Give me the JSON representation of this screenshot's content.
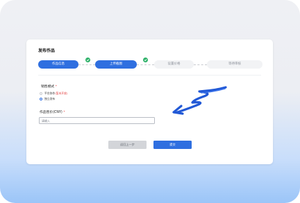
{
  "page": {
    "title": "发布作品"
  },
  "steps": [
    {
      "label": "作品信息",
      "status": "done"
    },
    {
      "label": "上传截图",
      "status": "done"
    },
    {
      "label": "设置价格",
      "status": "todo"
    },
    {
      "label": "等待审核",
      "status": "todo"
    }
  ],
  "sale_mode": {
    "label": "销售模式",
    "required_mark": "*",
    "options": [
      {
        "label": "平台协作",
        "note": "(暂未开放)",
        "selected": false
      },
      {
        "label": "独立发布",
        "selected": true
      }
    ]
  },
  "price": {
    "label": "作品售价(CNY)",
    "required_mark": "*",
    "placeholder": "请输入"
  },
  "buttons": {
    "prev": "返回上一步",
    "submit": "提交"
  },
  "colors": {
    "primary": "#2f6fe0",
    "check": "#2fb26a",
    "required": "#e23c3c"
  },
  "annotation": {
    "icon": "hand-drawn-arrow-icon"
  }
}
